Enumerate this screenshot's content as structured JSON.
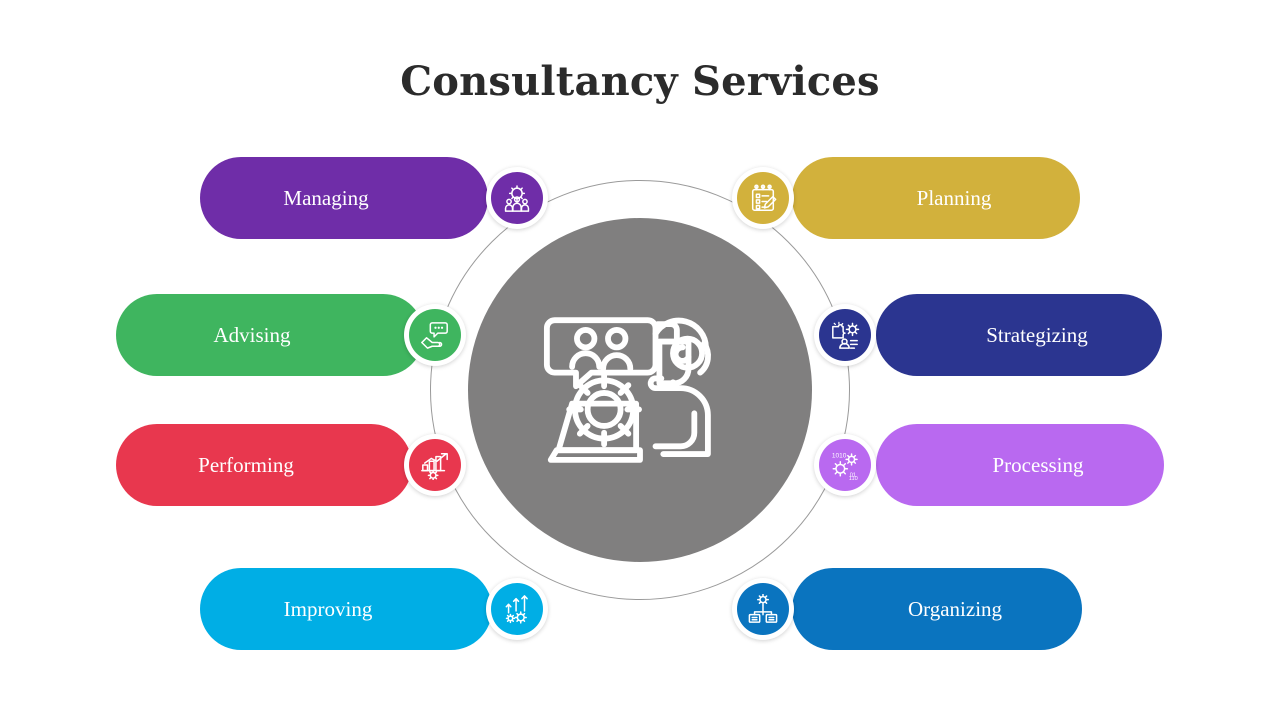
{
  "slide": {
    "title": "Consultancy Services",
    "background_color": "#ffffff",
    "title_color": "#2b2b2b"
  },
  "center": {
    "circle_color": "#807f7f",
    "ring_color": "#9a9a9a",
    "icon": "consultant-headset-laptop-gear-icon"
  },
  "items": [
    {
      "id": "managing",
      "label": "Managing",
      "side": "left",
      "color": "#6F2DA8",
      "icon": "gear-people-icon"
    },
    {
      "id": "planning",
      "label": "Planning",
      "side": "right",
      "color": "#D2B13C",
      "icon": "clipboard-checklist-pencil-icon"
    },
    {
      "id": "advising",
      "label": "Advising",
      "side": "left",
      "color": "#3FB55F",
      "icon": "hand-speech-bubble-icon"
    },
    {
      "id": "strategizing",
      "label": "Strategizing",
      "side": "right",
      "color": "#2B3590",
      "icon": "puzzle-gear-person-icon"
    },
    {
      "id": "performing",
      "label": "Performing",
      "side": "left",
      "color": "#E8374E",
      "icon": "bar-chart-arrow-gear-icon"
    },
    {
      "id": "processing",
      "label": "Processing",
      "side": "right",
      "color": "#B969F0",
      "icon": "gears-binary-icon"
    },
    {
      "id": "improving",
      "label": "Improving",
      "side": "left",
      "color": "#00AEE5",
      "icon": "up-arrows-gears-icon"
    },
    {
      "id": "organizing",
      "label": "Organizing",
      "side": "right",
      "color": "#0A74BF",
      "icon": "gear-org-chart-icon"
    }
  ]
}
